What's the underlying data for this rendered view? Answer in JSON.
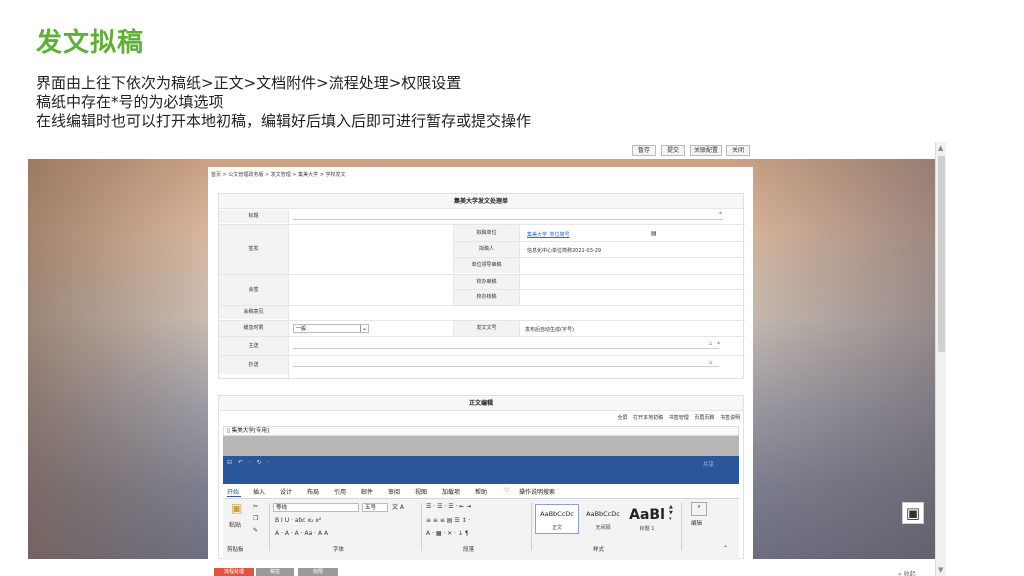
{
  "slide": {
    "title": "发文拟稿",
    "lines": [
      "界面由上往下依次为稿纸>正文>文档附件>流程处理>权限设置",
      "稿纸中存在*号的为必填选项",
      "在线编辑时也可以打开本地初稿，编辑好后填入后即可进行暂存或提交操作"
    ]
  },
  "toolbar": {
    "buttons": [
      "暂存",
      "提交",
      "关联配置",
      "关闭"
    ]
  },
  "breadcrumb": "首页 > 公文管理政务版 > 发文管理 > 集美大学 > 学校发文",
  "form": {
    "title": "集美大学发文处理单",
    "labels": {
      "title": "标题",
      "sign": "签发",
      "draft_unit": "拟稿单位",
      "drafter": "拟稿人",
      "unit_leader": "单位领导审稿",
      "proofread": "校办审稿",
      "verify": "校办核稿",
      "countersign": "会签",
      "countersign_opinion": "会稿意见",
      "urgency": "缓急时限",
      "doc_number": "发文文号",
      "main_send": "主送",
      "cc": "抄送"
    },
    "values": {
      "title_req": "*",
      "draft_unit": "集美大学_单位简号",
      "drafter": "信息化中心单位简称2021-03-29",
      "urgency": "一般",
      "doc_number": "发布后自动生成(字号)",
      "main_send_req": "*"
    }
  },
  "editor": {
    "title": "正文编辑",
    "tools": [
      "全屏",
      "打开本地初稿",
      "书签管理",
      "页眉页脚",
      "书签说明"
    ],
    "doc_name": "集美大学[专用]",
    "quick_access": "⊟ ↶ · ↻ ·",
    "ribbon_tabs": [
      "开始",
      "插入",
      "设计",
      "布局",
      "引用",
      "邮件",
      "审阅",
      "视图",
      "加载项",
      "帮助",
      "操作说明搜索"
    ],
    "search_hint": "共享",
    "font_name": "等线",
    "font_size": "五号",
    "paste_label": "粘贴",
    "groups": [
      "剪贴板",
      "字体",
      "段落",
      "样式",
      "编辑"
    ],
    "styles": [
      {
        "sample": "AaBbCcDc",
        "name": "正文"
      },
      {
        "sample": "AaBbCcDc",
        "name": "无间隔"
      },
      {
        "sample": "AaBl",
        "name": "标题 1"
      }
    ],
    "font_buttons": "B  I  U · abc  x₂  x²",
    "font_buttons2": "A · A · A · Aa ·  A  A",
    "para_buttons": "☰ · ☰ · ☰ ·  ⇤ ⇥",
    "para_buttons2": "≡ ≡ ≡ ▤ ☰  ↕ ·",
    "para_buttons3": "A · ▦ ·  ✕ ·  ↓  ¶"
  },
  "bottom_tabs": [
    "流程处理",
    "稿签",
    "权限"
  ],
  "collapse_label": "收起"
}
